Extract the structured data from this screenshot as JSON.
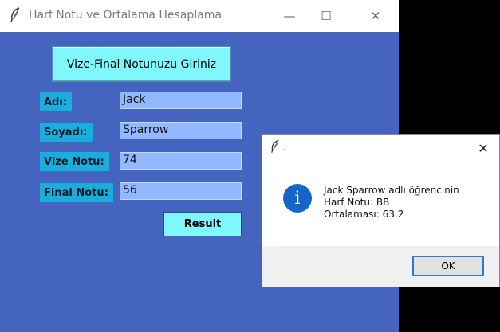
{
  "window": {
    "title": "Harf Notu ve Ortalama Hesaplama",
    "minimize": "—",
    "maximize": "☐",
    "close": "✕"
  },
  "form": {
    "header_button": "Vize-Final Notunuzu Giriniz",
    "fields": [
      {
        "label": "Adı:",
        "value": "Jack"
      },
      {
        "label": "Soyadı:",
        "value": "Sparrow"
      },
      {
        "label": "Vize Notu:",
        "value": "74"
      },
      {
        "label": "Final Notu:",
        "value": "56"
      }
    ],
    "result_button": "Result"
  },
  "dialog": {
    "title": ".",
    "close": "✕",
    "icon_glyph": "i",
    "lines": [
      "Jack Sparrow adlı öğrencinin",
      "Harf Notu: BB",
      "Ortalaması: 63.2"
    ],
    "ok_label": "OK"
  },
  "colors": {
    "window_bg": "#4564bf",
    "button_bg": "#7ff7fb",
    "label_bg": "#1aaedc",
    "input_bg": "#92b8ff",
    "info_blue": "#1565c8",
    "ok_border": "#2b7bd1"
  },
  "icons": [
    "feather-icon",
    "minimize-icon",
    "maximize-icon",
    "close-icon",
    "info-icon"
  ]
}
